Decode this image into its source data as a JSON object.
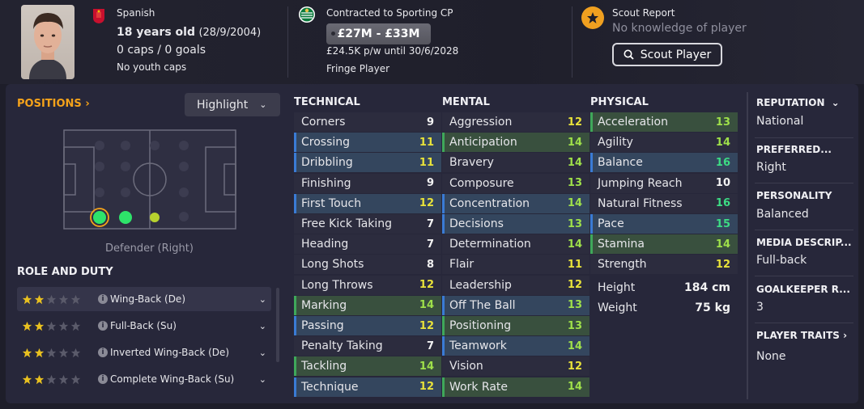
{
  "header": {
    "nationality": "Spanish",
    "age": "18 years old",
    "dob": "(28/9/2004)",
    "caps": "0 caps / 0 goals",
    "youth_caps": "No youth caps",
    "contract": "Contracted to Sporting CP",
    "value_range": "£27M - £33M",
    "wage": "£24.5K p/w until 30/6/2028",
    "squad_status": "Fringe Player",
    "scout_title": "Scout Report",
    "scout_sub": "No knowledge of player",
    "scout_button": "Scout Player"
  },
  "positions": {
    "title": "POSITIONS",
    "highlight_label": "Highlight",
    "position_label": "Defender (Right)"
  },
  "role_duty": {
    "title": "ROLE AND DUTY",
    "roles": [
      {
        "name": "Wing-Back (De)",
        "stars": 2
      },
      {
        "name": "Full-Back (Su)",
        "stars": 2
      },
      {
        "name": "Inverted Wing-Back (De)",
        "stars": 2
      },
      {
        "name": "Complete Wing-Back (Su)",
        "stars": 2
      }
    ]
  },
  "technical": {
    "title": "TECHNICAL",
    "attrs": [
      {
        "name": "Corners",
        "value": "9"
      },
      {
        "name": "Crossing",
        "value": "11"
      },
      {
        "name": "Dribbling",
        "value": "11"
      },
      {
        "name": "Finishing",
        "value": "9"
      },
      {
        "name": "First Touch",
        "value": "12"
      },
      {
        "name": "Free Kick Taking",
        "value": "7"
      },
      {
        "name": "Heading",
        "value": "7"
      },
      {
        "name": "Long Shots",
        "value": "8"
      },
      {
        "name": "Long Throws",
        "value": "12"
      },
      {
        "name": "Marking",
        "value": "14"
      },
      {
        "name": "Passing",
        "value": "12"
      },
      {
        "name": "Penalty Taking",
        "value": "7"
      },
      {
        "name": "Tackling",
        "value": "14"
      },
      {
        "name": "Technique",
        "value": "12"
      }
    ]
  },
  "mental": {
    "title": "MENTAL",
    "attrs": [
      {
        "name": "Aggression",
        "value": "12"
      },
      {
        "name": "Anticipation",
        "value": "14"
      },
      {
        "name": "Bravery",
        "value": "14"
      },
      {
        "name": "Composure",
        "value": "13"
      },
      {
        "name": "Concentration",
        "value": "14"
      },
      {
        "name": "Decisions",
        "value": "13"
      },
      {
        "name": "Determination",
        "value": "14"
      },
      {
        "name": "Flair",
        "value": "11"
      },
      {
        "name": "Leadership",
        "value": "12"
      },
      {
        "name": "Off The Ball",
        "value": "13"
      },
      {
        "name": "Positioning",
        "value": "13"
      },
      {
        "name": "Teamwork",
        "value": "14"
      },
      {
        "name": "Vision",
        "value": "12"
      },
      {
        "name": "Work Rate",
        "value": "14"
      }
    ]
  },
  "physical": {
    "title": "PHYSICAL",
    "attrs": [
      {
        "name": "Acceleration",
        "value": "13"
      },
      {
        "name": "Agility",
        "value": "14"
      },
      {
        "name": "Balance",
        "value": "16"
      },
      {
        "name": "Jumping Reach",
        "value": "10"
      },
      {
        "name": "Natural Fitness",
        "value": "16"
      },
      {
        "name": "Pace",
        "value": "15"
      },
      {
        "name": "Stamina",
        "value": "14"
      },
      {
        "name": "Strength",
        "value": "12"
      }
    ],
    "height_label": "Height",
    "height_value": "184 cm",
    "weight_label": "Weight",
    "weight_value": "75 kg"
  },
  "info": {
    "reputation_title": "REPUTATION",
    "reputation_value": "National",
    "preferred_title": "PREFERRED...",
    "preferred_value": "Right",
    "personality_title": "PERSONALITY",
    "personality_value": "Balanced",
    "media_title": "MEDIA DESCRIP...",
    "media_value": "Full-back",
    "gk_title": "GOALKEEPER R...",
    "gk_value": "3",
    "traits_title": "PLAYER TRAITS",
    "traits_value": "None"
  },
  "colors": {
    "accent_orange": "#f5a31a",
    "value_white": "#f2f2f2",
    "value_yellow": "#e8e23a",
    "value_green": "#3ddc84",
    "value_light_green": "#9fe04a"
  }
}
